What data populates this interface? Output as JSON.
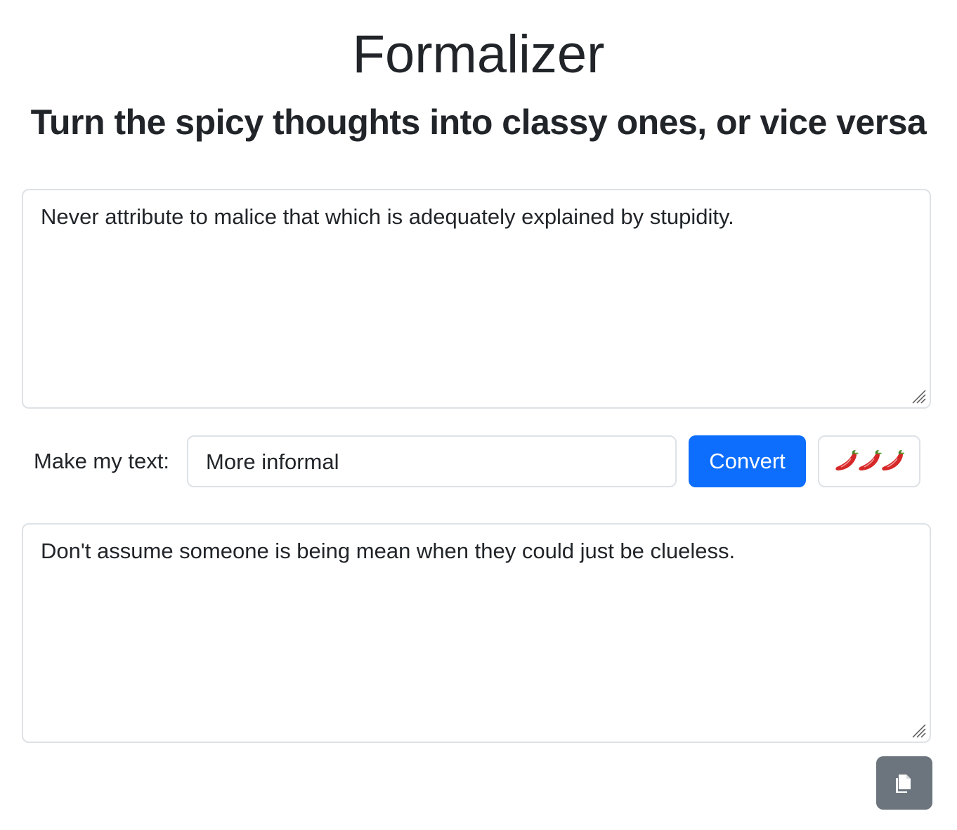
{
  "header": {
    "title": "Formalizer",
    "subtitle": "Turn the spicy thoughts into classy ones, or vice versa"
  },
  "input": {
    "text": "Never attribute to malice that which is adequately explained by stupidity."
  },
  "controls": {
    "label": "Make my text:",
    "style_selected": "More informal",
    "convert_label": "Convert",
    "spice_icon": "chili-pepper-icon x3",
    "spice_count": 3
  },
  "output": {
    "text": "Don't assume someone is being mean when they could just be clueless."
  },
  "actions": {
    "copy_icon": "copy-icon"
  },
  "colors": {
    "primary": "#0d6efd",
    "secondary": "#6c757d",
    "border": "#dee2e6",
    "text": "#212529"
  }
}
